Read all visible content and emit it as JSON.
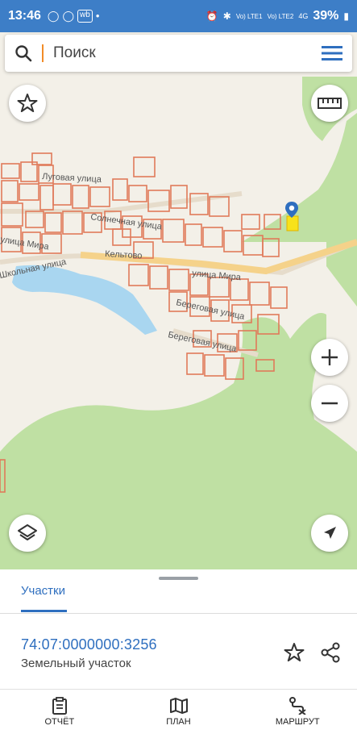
{
  "status_bar": {
    "time": "13:46",
    "app_icons": [
      "whatsapp-icon",
      "whatsapp-icon",
      "wb-icon",
      "dot"
    ],
    "wb_label": "wb",
    "network_labels": [
      "Vo) LTE1",
      "Vo) LTE2",
      "4G"
    ],
    "battery": "39%"
  },
  "search": {
    "placeholder": "Поиск"
  },
  "map": {
    "labels": {
      "street_1": "Луговая улица",
      "street_2": "Солнечная улица",
      "street_3": "улица Мира",
      "street_4": "Школьная улица",
      "village": "Кельтово",
      "street_5": "улица Мира",
      "street_6": "Береговая улица",
      "street_7": "Береговая улица"
    },
    "colors": {
      "background": "#f3f0e8",
      "forest": "#bfe0a3",
      "water": "#a9d6f0",
      "parcel": "#e07a5a",
      "road": "#f5d28a",
      "selected": "#f7e21a",
      "pin": "#2f6fbf"
    }
  },
  "sheet": {
    "tab_label": "Участки",
    "cadastral_number": "74:07:0000000:3256",
    "parcel_type": "Земельный участок"
  },
  "bottom_nav": {
    "report": "ОТЧЁТ",
    "plan": "ПЛАН",
    "route": "МАРШРУТ"
  }
}
